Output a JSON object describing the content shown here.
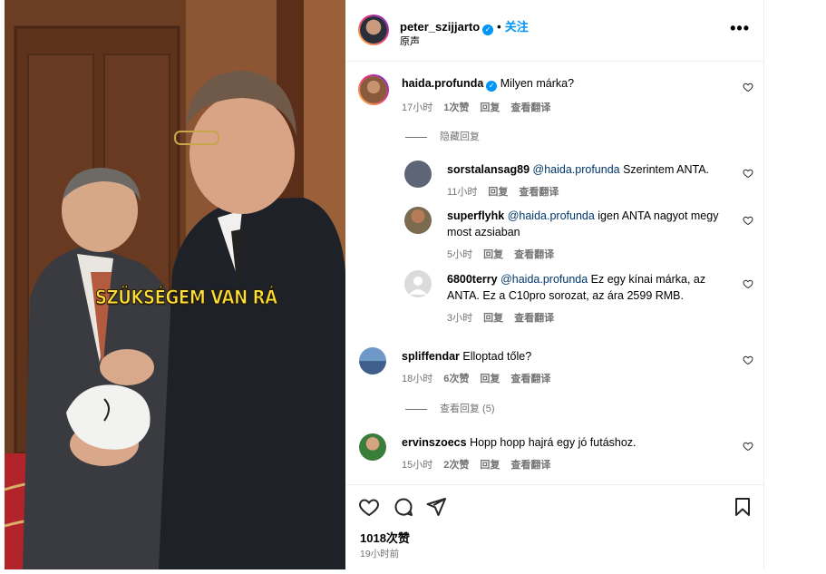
{
  "post": {
    "author": "peter_szijjarto",
    "follow_label": "关注",
    "dot": "•",
    "audio_label": "原声",
    "more_label": "•••",
    "video_caption": "SZÜKSÉGEM VAN RÁ",
    "likes_text": "1018次赞",
    "time_text": "19小时前"
  },
  "comments": [
    {
      "user": "haida.profunda",
      "verified": true,
      "text": "Milyen márka?",
      "time": "17小时",
      "likes": "1次赞",
      "reply": "回复",
      "translate": "查看翻译",
      "toggle": "隐藏回复",
      "avatar_color": "#8a5a3c",
      "replies": [
        {
          "user": "sorstalansag89",
          "mention": "@haida.profunda",
          "text": "Szerintem ANTA.",
          "time": "11小时",
          "reply": "回复",
          "translate": "查看翻译",
          "avatar_color": "#5d6577"
        },
        {
          "user": "superflyhk",
          "mention": "@haida.profunda",
          "text": "igen ANTA nagyot megy most azsiaban",
          "time": "5小时",
          "reply": "回复",
          "translate": "查看翻译",
          "avatar_color": "#7a6b4f"
        },
        {
          "user": "6800terry",
          "mention": "@haida.profunda",
          "text": "Ez egy kínai márka, az ANTA. Ez a C10pro sorozat, az ára 2599 RMB.",
          "time": "3小时",
          "reply": "回复",
          "translate": "查看翻译",
          "avatar_color": "#dbdbdb"
        }
      ]
    },
    {
      "user": "spliffendar",
      "text": "Elloptad tőle?",
      "time": "18小时",
      "likes": "6次赞",
      "reply": "回复",
      "translate": "查看翻译",
      "toggle": "查看回复 (5)",
      "avatar_color": "#3f5f8a"
    },
    {
      "user": "ervinszoecs",
      "text": "Hopp hopp hajrá egy jó futáshoz.",
      "time": "15小时",
      "likes": "2次赞",
      "reply": "回复",
      "translate": "查看翻译",
      "avatar_color": "#3b7d3a"
    }
  ],
  "icons": {
    "like": "heart-icon",
    "comment": "comment-icon",
    "share": "send-icon",
    "save": "bookmark-icon",
    "verified": "verified-badge-icon"
  },
  "colors": {
    "accent": "#0095f6",
    "mention": "#00376b",
    "meta": "#737373",
    "caption": "#fbe03a"
  }
}
